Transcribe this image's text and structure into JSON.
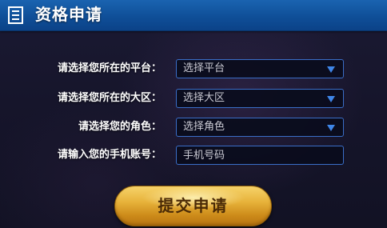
{
  "header": {
    "title": "资格申请"
  },
  "form": {
    "platform": {
      "label": "请选择您所在的平台：",
      "value": "选择平台"
    },
    "region": {
      "label": "请选择您所在的大区：",
      "value": "选择大区"
    },
    "role": {
      "label": "请选择您的角色：",
      "value": "选择角色"
    },
    "phone": {
      "label": "请输入您的手机账号：",
      "placeholder": "手机号码"
    },
    "submit_label": "提交申请"
  },
  "colors": {
    "header_blue": "#0f4f98",
    "field_border": "#3a6ec8",
    "arrow_blue": "#3f86e8",
    "button_gold": "#e7b23a"
  },
  "icons": {
    "header_icon": "document-list-icon",
    "dropdown_icon": "chevron-down-icon"
  }
}
